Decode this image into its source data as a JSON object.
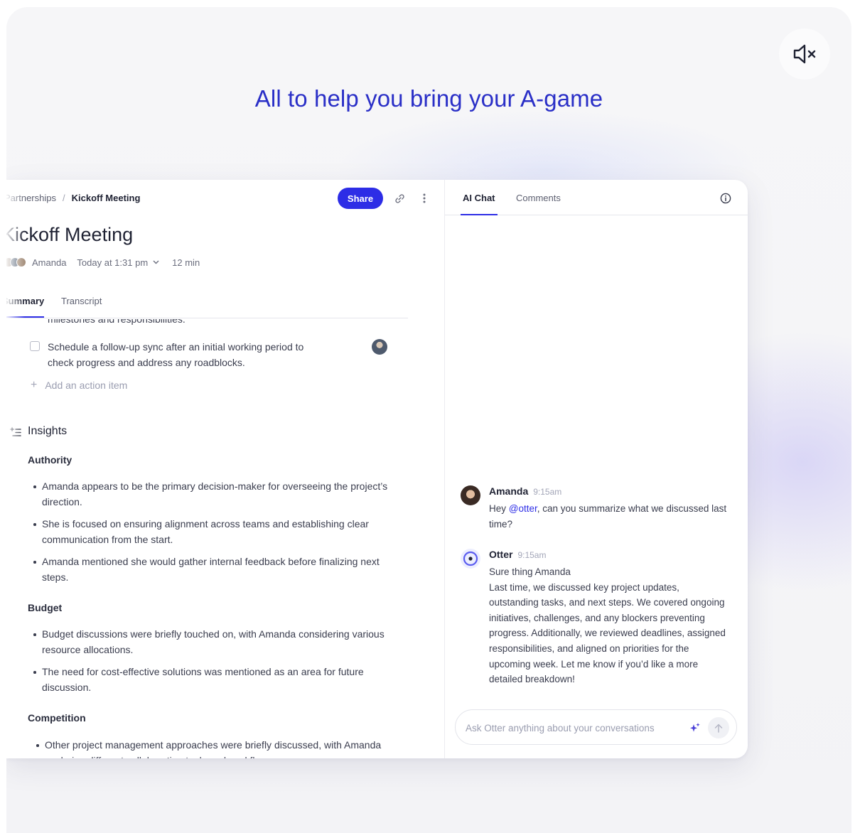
{
  "headline": "All to help you bring your A-game",
  "icons": {
    "mute": "speaker-muted-icon",
    "link": "link-icon",
    "more": "more-vertical-icon",
    "info": "info-icon",
    "insights": "sparkle-list-icon",
    "sparkle": "sparkle-icon",
    "send": "arrow-up-icon",
    "chevron": "chevron-down-icon"
  },
  "colors": {
    "accent": "#2d2de6",
    "headline": "#2a2fc7"
  },
  "note": {
    "breadcrumb": {
      "parent": "Partnerships",
      "separator": "/",
      "current": "Kickoff Meeting"
    },
    "share_label": "Share",
    "title": "Kickoff Meeting",
    "meta": {
      "owner": "Amanda",
      "datetime": "Today at 1:31 pm",
      "duration": "12 min"
    },
    "tabs": [
      {
        "label": "Summary",
        "active": true
      },
      {
        "label": "Transcript",
        "active": false
      }
    ],
    "cut_off_text": "milestones and responsibilities.",
    "action_item": "Schedule a follow-up sync after an initial working period to check progress and address any roadblocks.",
    "add_action_label": "Add an action item",
    "insights_title": "Insights",
    "sections": [
      {
        "title": "Authority",
        "bullets": [
          "Amanda appears to be the primary decision-maker for overseeing the project’s direction.",
          "She is focused on ensuring alignment across teams and establishing clear communication from the start.",
          "Amanda mentioned she would gather internal feedback before finalizing next steps."
        ]
      },
      {
        "title": "Budget",
        "bullets": [
          "Budget discussions were briefly touched on, with Amanda considering various resource allocations.",
          "The need for cost-effective solutions was mentioned as an area for future discussion."
        ]
      },
      {
        "title": "Competition",
        "bullets": [
          "Other project management approaches were briefly discussed, with Amanda exploring different collaboration tools and workflows."
        ]
      }
    ]
  },
  "chat": {
    "tabs": [
      {
        "label": "AI Chat",
        "active": true
      },
      {
        "label": "Comments",
        "active": false
      }
    ],
    "messages": [
      {
        "author": "Amanda",
        "time": "9:15am",
        "text_before": "Hey ",
        "mention": "@otter",
        "text_after": ", can you summarize what we discussed last time?"
      },
      {
        "author": "Otter",
        "time": "9:15am",
        "line1": "Sure thing Amanda",
        "text": "Last time, we discussed key project updates, outstanding tasks, and next steps. We covered ongoing initiatives, challenges, and any blockers preventing progress. Additionally, we reviewed deadlines, assigned responsibilities, and aligned on priorities for the upcoming week. Let me know if you’d like a more detailed breakdown!"
      }
    ],
    "input_placeholder": "Ask Otter anything about your conversations"
  }
}
